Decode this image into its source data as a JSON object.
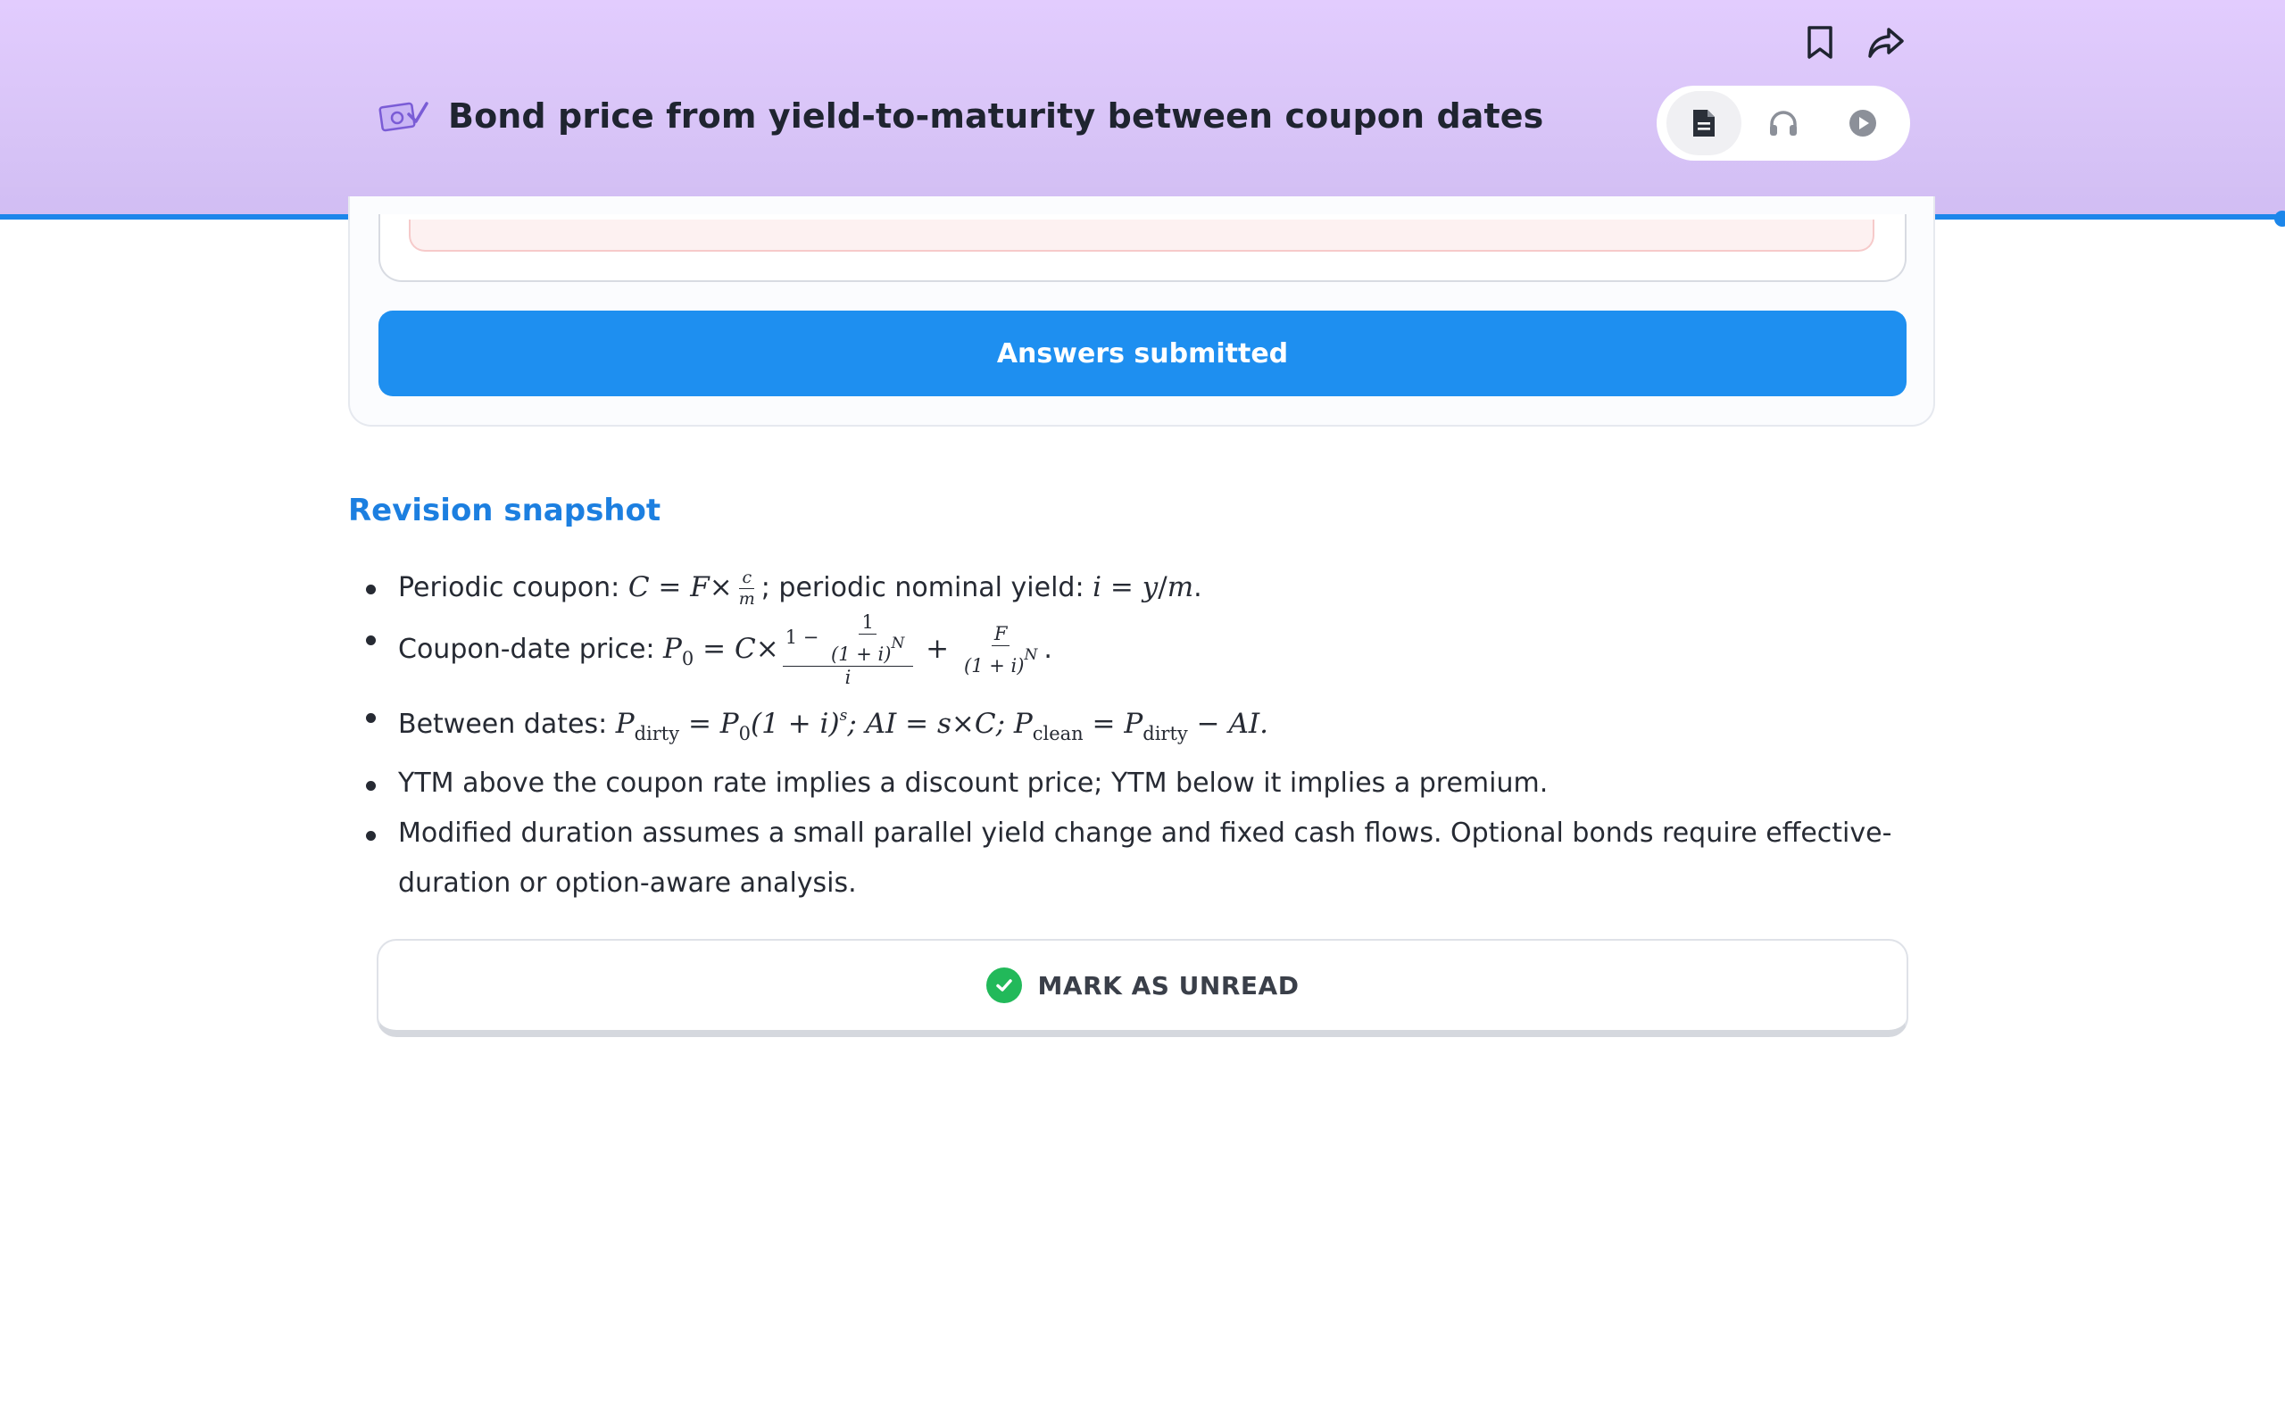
{
  "header": {
    "title": "Bond price from yield-to-maturity between coupon dates",
    "lesson_icon": "money-check-icon",
    "top_actions": [
      {
        "name": "bookmark-icon"
      },
      {
        "name": "share-icon"
      }
    ],
    "modes": [
      {
        "name": "document-icon",
        "active": true
      },
      {
        "name": "headphones-icon",
        "active": false
      },
      {
        "name": "play-icon",
        "active": false
      }
    ],
    "accent_color": "#1c86ea"
  },
  "quiz": {
    "submit_label": "Answers submitted",
    "submit_color": "#1e8ff0"
  },
  "revision": {
    "heading": "Revision snapshot",
    "b1": {
      "label": "Periodic coupon: ",
      "mid": "; periodic nominal yield: "
    },
    "b2": {
      "label": "Coupon-date price: "
    },
    "b3": {
      "label": "Between dates: "
    },
    "b4": "YTM above the coupon rate implies a discount price; YTM below it implies a premium.",
    "b5": "Modified duration assumes a small parallel yield change and fixed cash flows. Optional bonds require effective-duration or option-aware analysis."
  },
  "footer": {
    "mark_label": "MARK AS UNREAD",
    "check_color": "#22b95a"
  }
}
